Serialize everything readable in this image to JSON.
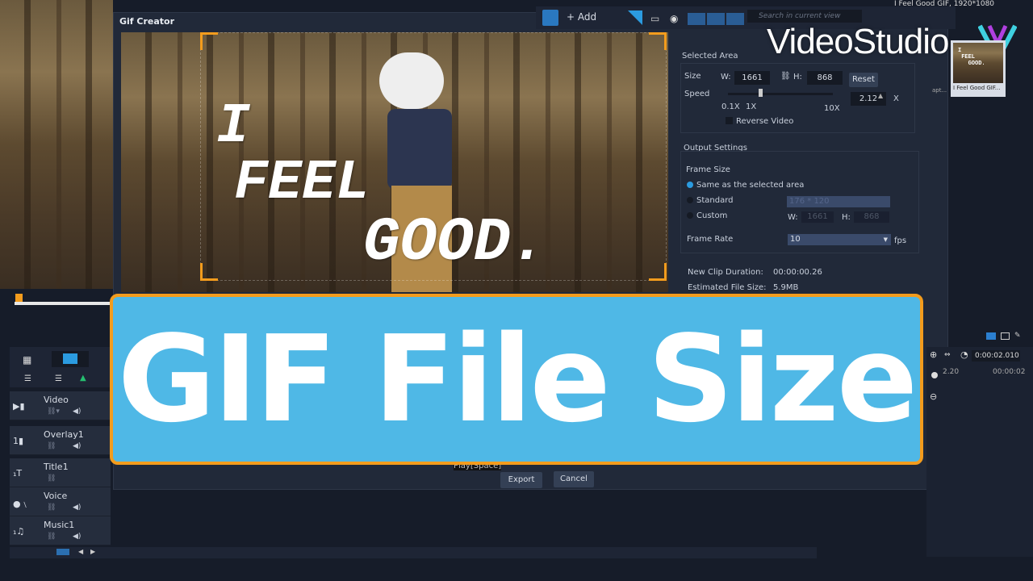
{
  "window": {
    "title": "Gif Creator",
    "project_info": "I Feel Good GIF, 1920*1080"
  },
  "toolbar": {
    "add_label": "Add",
    "search_placeholder": "Search in current view"
  },
  "brand": {
    "logo_text": "VideoStudio",
    "accent": "#4fb8e6",
    "border": "#f39c1d"
  },
  "library": {
    "thumb_caption": "I Feel Good GIF...",
    "thumb_caption_left": "apt..."
  },
  "video_text": [
    "I",
    "FEEL",
    "GOOD."
  ],
  "selected_area": {
    "title": "Selected Area",
    "size_label": "Size",
    "w_label": "W:",
    "w_value": "1661",
    "h_label": "H:",
    "h_value": "868",
    "reset_label": "Reset",
    "speed_label": "Speed",
    "speed_ticks": [
      "0.1X",
      "1X",
      "10X"
    ],
    "speed_value": "2.12",
    "speed_unit": "X",
    "reverse_label": "Reverse Video",
    "reverse_checked": false
  },
  "output_settings": {
    "title": "Output Settings",
    "frame_size_label": "Frame Size",
    "options": [
      {
        "label": "Same as the selected area",
        "selected": true
      },
      {
        "label": "Standard",
        "selected": false
      },
      {
        "label": "Custom",
        "selected": false
      }
    ],
    "standard_value": "176 * 120",
    "custom_w_label": "W:",
    "custom_w": "1661",
    "custom_h_label": "H:",
    "custom_h": "868",
    "frame_rate_label": "Frame Rate",
    "frame_rate_value": "10",
    "fps_label": "fps"
  },
  "info": {
    "duration_label": "New Clip Duration:",
    "duration_value": "00:00:00.26",
    "size_label": "Estimated File Size:",
    "size_value": "5.9MB"
  },
  "footer": {
    "play_hint": "Play[Space]",
    "export_label": "Export",
    "cancel_label": "Cancel"
  },
  "banner": {
    "text": "GIF File Size"
  },
  "timeline": {
    "timecode": "0:00:02.010",
    "ruler": [
      "2.20",
      "00:00:02"
    ],
    "tracks": [
      {
        "name": "Video",
        "icon": "video-track-icon"
      },
      {
        "name": "Overlay1",
        "icon": "overlay-track-icon"
      },
      {
        "name": "Title1",
        "icon": "title-track-icon"
      },
      {
        "name": "Voice",
        "icon": "microphone-icon"
      },
      {
        "name": "Music1",
        "icon": "music-icon"
      }
    ]
  }
}
